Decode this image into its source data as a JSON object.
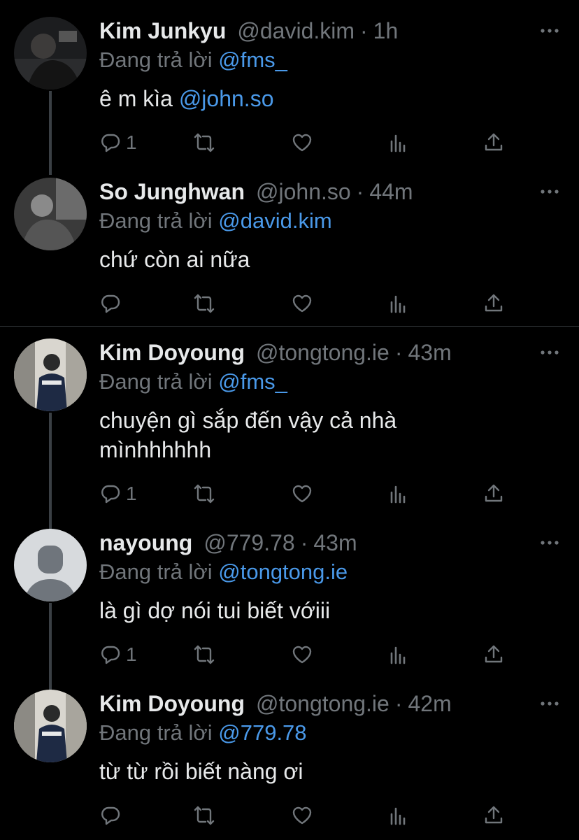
{
  "thread": [
    {
      "name": "Kim Junkyu",
      "handle": "@david.kim",
      "time": "1h",
      "replying_prefix": "Đang trả lời",
      "replying_to": "@fms_",
      "text": "ê m kìa ",
      "text_mention": "@john.so",
      "reply_count": "1",
      "avatar": "photo-dark"
    },
    {
      "name": "So Junghwan",
      "handle": "@john.so",
      "time": "44m",
      "replying_prefix": "Đang trả lời",
      "replying_to": "@david.kim",
      "text": "chứ còn ai nữa",
      "reply_count": "",
      "avatar": "photo-gray"
    },
    {
      "name": "Kim Doyoung",
      "handle": "@tongtong.ie",
      "time": "43m",
      "replying_prefix": "Đang trả lời",
      "replying_to": "@fms_",
      "text": "chuyện gì sắp đến vậy cả nhà mìnhhhhhh",
      "reply_count": "1",
      "avatar": "photo-street"
    },
    {
      "name": "nayoung",
      "handle": "@779.78",
      "time": "43m",
      "replying_prefix": "Đang trả lời",
      "replying_to": "@tongtong.ie",
      "text": "là gì dợ nói tui biết vớiii",
      "reply_count": "1",
      "avatar": "default-avatar"
    },
    {
      "name": "Kim Doyoung",
      "handle": "@tongtong.ie",
      "time": "42m",
      "replying_prefix": "Đang trả lời",
      "replying_to": "@779.78",
      "text": "từ từ rồi biết nàng ơi",
      "reply_count": "",
      "avatar": "photo-street"
    }
  ],
  "time_separator": "·",
  "icons": {
    "reply": "reply-icon",
    "retweet": "retweet-icon",
    "like": "heart-icon",
    "views": "analytics-icon",
    "share": "share-icon",
    "more": "more-icon"
  },
  "colors": {
    "background": "#000000",
    "text": "#e7e9ea",
    "muted": "#71767b",
    "mention": "#4a99e9",
    "thread_line": "#3a3f44"
  }
}
